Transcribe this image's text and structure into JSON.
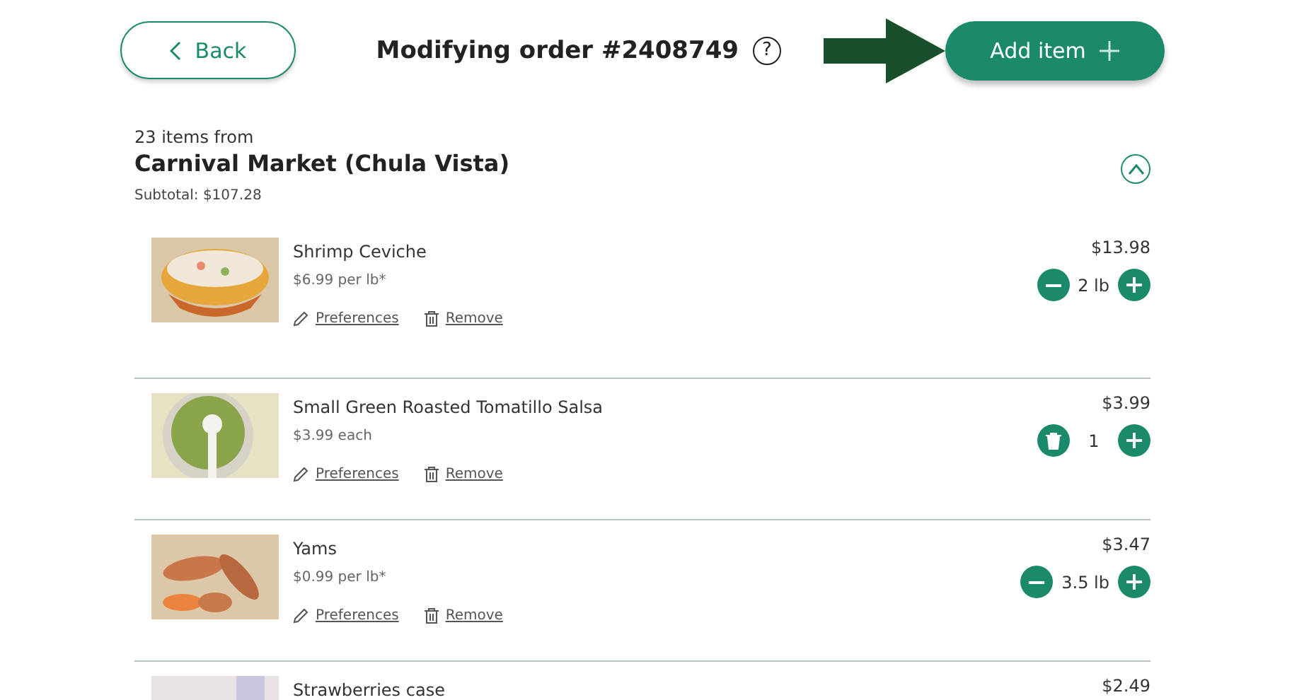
{
  "header": {
    "back": "Back",
    "title": "Modifying order #2408749",
    "help": "?",
    "add": "Add item"
  },
  "store": {
    "count": "23 items from",
    "name": "Carnival Market (Chula Vista)",
    "subtotal": "Subtotal: $107.28",
    "expanded": true
  },
  "items": [
    {
      "name": "Shrimp Ceviche",
      "unit": "$6.99 per lb*",
      "price": "$13.98",
      "qty": "2 lb",
      "at_minimum": false,
      "preferences": "Preferences",
      "remove": "Remove",
      "kind": "picture"
    },
    {
      "name": "Small Green Roasted Tomatillo Salsa",
      "unit": "$3.99 each",
      "price": "$3.99",
      "qty": "1",
      "at_minimum": true,
      "preferences": "Preferences",
      "remove": "Remove",
      "kind": "picture"
    },
    {
      "name": "Yams",
      "unit": "$0.99 per lb*",
      "price": "$3.47",
      "qty": "3.5 lb",
      "at_minimum": false,
      "preferences": "Preferences",
      "remove": "Remove",
      "kind": "picture"
    },
    {
      "name": "Strawberries case",
      "price": "$2.49",
      "kind": "picture"
    }
  ]
}
